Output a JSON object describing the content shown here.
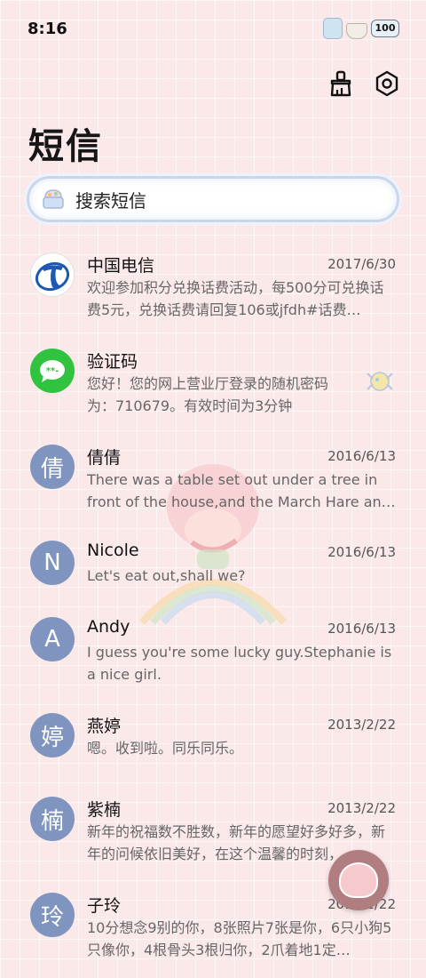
{
  "status": {
    "time": "8:16",
    "battery": "100"
  },
  "header": {
    "title": "短信"
  },
  "search": {
    "placeholder": "搜索短信"
  },
  "messages": [
    {
      "name": "中国电信",
      "date": "2017/6/30",
      "preview": "欢迎参加积分兑换话费活动，每500分可兑换话费5元，兑换话费请回复106或jfdh#话费…",
      "avatar": "",
      "avatar_type": "china-telecom-logo"
    },
    {
      "name": "验证码",
      "date": "",
      "preview": "您好！您的网上营业厅登录的随机密码为：710679。有效时间为3分钟",
      "avatar": "",
      "avatar_type": "chat-bubble-icon"
    },
    {
      "name": "倩倩",
      "date": "2016/6/13",
      "preview": "There was a table set out under a tree in front of the house,and the March Hare an…",
      "avatar": "倩"
    },
    {
      "name": "Nicole",
      "date": "2016/6/13",
      "preview": "Let's eat out,shall we?",
      "avatar": "N"
    },
    {
      "name": "Andy",
      "date": "2016/6/13",
      "preview": "I guess you're some lucky guy.Stephanie is a nice girl.",
      "avatar": "A"
    },
    {
      "name": "燕婷",
      "date": "2013/2/22",
      "preview": "嗯。收到啦。同乐同乐。",
      "avatar": "婷"
    },
    {
      "name": "紫楠",
      "date": "2013/2/22",
      "preview": "新年的祝福数不胜数，新年的愿望好多好多，新年的问候依旧美好，在这个温馨的时刻，…",
      "avatar": "楠"
    },
    {
      "name": "子玲",
      "date": "2013/2/22",
      "preview": "10分想念9别的你，8张照片7张是你，6只小狗5只像你，4根骨头3根归你，2爪着地1定…",
      "avatar": "玲"
    }
  ],
  "icons": {
    "clean": "broom-icon",
    "settings": "gear-icon",
    "new_message": "compose-fab-icon"
  },
  "colors": {
    "background": "#fbe9ea",
    "avatar": "#7f94bf",
    "telecom_blue": "#1e58b3",
    "wechat_green": "#2fc33f"
  }
}
